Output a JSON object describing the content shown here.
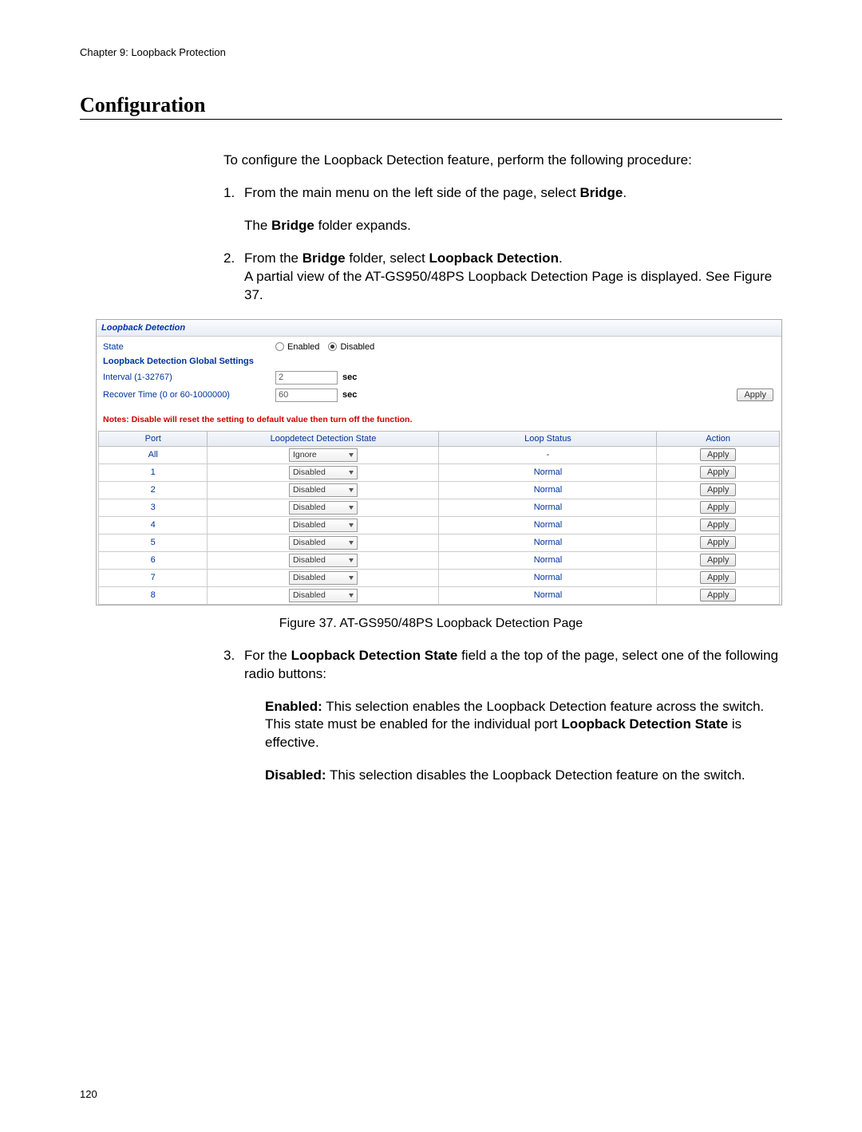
{
  "header": {
    "chapter": "Chapter 9: Loopback Protection"
  },
  "section": {
    "title": "Configuration"
  },
  "intro": "To configure the Loopback Detection feature, perform the following procedure:",
  "steps": {
    "s1": {
      "num": "1.",
      "text_pre": "From the main menu on the left side of the page, select ",
      "bold1": "Bridge",
      "text_post": ".",
      "sub_pre": "The ",
      "sub_bold": "Bridge",
      "sub_post": " folder expands."
    },
    "s2": {
      "num": "2.",
      "line1_pre": "From the ",
      "line1_b1": "Bridge",
      "line1_mid": " folder, select ",
      "line1_b2": "Loopback Detection",
      "line1_post": ".",
      "line2": "A partial view of the AT-GS950/48PS Loopback Detection Page is displayed. See Figure 37."
    },
    "s3": {
      "num": "3.",
      "line_pre": "For the ",
      "line_bold": "Loopback Detection State",
      "line_post": " field a the top of the page, select one of the following radio buttons:",
      "enabled_label": "Enabled:",
      "enabled_text_a": " This selection enables the Loopback Detection feature across the switch. This state must be enabled for the individual port ",
      "enabled_bold_mid": "Loopback Detection State",
      "enabled_text_b": " is effective.",
      "disabled_label": "Disabled:",
      "disabled_text": " This selection disables the Loopback Detection feature on the switch."
    }
  },
  "figure": {
    "caption": "Figure 37. AT-GS950/48PS Loopback Detection Page",
    "panel_title": "Loopback Detection",
    "state_label": "State",
    "radio_enabled": "Enabled",
    "radio_disabled": "Disabled",
    "global_title": "Loopback Detection Global Settings",
    "interval_label": "Interval (1-32767)",
    "interval_value": "2",
    "recover_label": "Recover Time (0 or 60-1000000)",
    "recover_value": "60",
    "unit": "sec",
    "apply": "Apply",
    "notes": "Notes: Disable will reset the setting to default value then turn off the function.",
    "cols": {
      "port": "Port",
      "state": "Loopdetect Detection State",
      "status": "Loop Status",
      "action": "Action"
    },
    "rows": [
      {
        "port": "All",
        "state": "Ignore",
        "status": "-",
        "action": "Apply"
      },
      {
        "port": "1",
        "state": "Disabled",
        "status": "Normal",
        "action": "Apply"
      },
      {
        "port": "2",
        "state": "Disabled",
        "status": "Normal",
        "action": "Apply"
      },
      {
        "port": "3",
        "state": "Disabled",
        "status": "Normal",
        "action": "Apply"
      },
      {
        "port": "4",
        "state": "Disabled",
        "status": "Normal",
        "action": "Apply"
      },
      {
        "port": "5",
        "state": "Disabled",
        "status": "Normal",
        "action": "Apply"
      },
      {
        "port": "6",
        "state": "Disabled",
        "status": "Normal",
        "action": "Apply"
      },
      {
        "port": "7",
        "state": "Disabled",
        "status": "Normal",
        "action": "Apply"
      },
      {
        "port": "8",
        "state": "Disabled",
        "status": "Normal",
        "action": "Apply"
      }
    ]
  },
  "footer": {
    "page": "120"
  }
}
